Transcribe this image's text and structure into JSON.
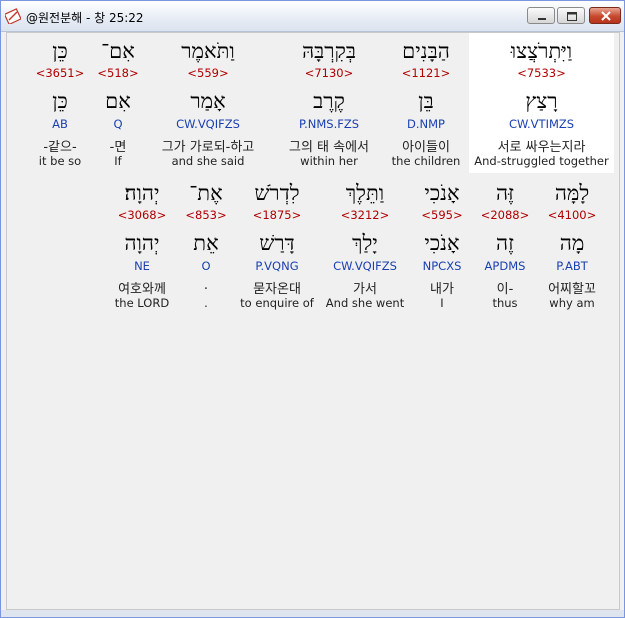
{
  "window": {
    "title": "@원전분해 - 창 25:22"
  },
  "row1": [
    {
      "hebrew": "וַיִּתְרֹצֲצוּ",
      "strong": "<7533>",
      "lemma": "רָצַץ",
      "parse": "CW.VTIMZS",
      "korean": "서로 싸우는지라",
      "english": "And-struggled together"
    },
    {
      "hebrew": "הַבָּנִים",
      "strong": "<1121>",
      "lemma": "בֵּן",
      "parse": "D.NMP",
      "korean": "아이들이",
      "english": "the children"
    },
    {
      "hebrew": "בְּקִרְבָּהּ",
      "strong": "<7130>",
      "lemma": "קֶרֶב",
      "parse": "P.NMS.FZS",
      "korean": "그의 태 속에서",
      "english": "within her"
    },
    {
      "hebrew": "וַתֹּאמֶר",
      "strong": "<559>",
      "lemma": "אָמַר",
      "parse": "CW.VQIFZS",
      "korean": "그가 가로되-하고",
      "english": "and she said"
    },
    {
      "hebrew": "אִם־",
      "strong": "<518>",
      "lemma": "אִם",
      "parse": "Q",
      "korean": "-면",
      "english": "If"
    },
    {
      "hebrew": "כֵּן",
      "strong": "<3651>",
      "lemma": "כֵּן",
      "parse": "AB",
      "korean": "-같으-",
      "english": "it be so"
    }
  ],
  "row2": [
    {
      "hebrew": "לָמָּה",
      "strong": "<4100>",
      "lemma": "מָה",
      "parse": "P.ABT",
      "korean": "어찌할꼬",
      "english": "why am"
    },
    {
      "hebrew": "זֶּה",
      "strong": "<2088>",
      "lemma": "זֶה",
      "parse": "APDMS",
      "korean": "이-",
      "english": "thus"
    },
    {
      "hebrew": "אָנֹכִי",
      "strong": "<595>",
      "lemma": "אָנֹכִי",
      "parse": "NPCXS",
      "korean": "내가",
      "english": "I"
    },
    {
      "hebrew": "וַתֵּלֶךְ",
      "strong": "<3212>",
      "lemma": "יָלַךְ",
      "parse": "CW.VQIFZS",
      "korean": "가서",
      "english": "And she went"
    },
    {
      "hebrew": "לִדְרֹשׁ",
      "strong": "<1875>",
      "lemma": "דָּרַשׁ",
      "parse": "P.VQNG",
      "korean": "묻자온대",
      "english": "to enquire of"
    },
    {
      "hebrew": "אֶת־",
      "strong": "<853>",
      "lemma": "אֵת",
      "parse": "O",
      "korean": ".",
      "english": "."
    },
    {
      "hebrew": "יְהוָה׃",
      "strong": "<3068>",
      "lemma": "יְהוָה",
      "parse": "NE",
      "korean": "여호와께",
      "english": "the LORD"
    }
  ],
  "colors": {
    "strong": "#b00000",
    "parse": "#1a3fb0",
    "highlight": "#ffffff"
  }
}
